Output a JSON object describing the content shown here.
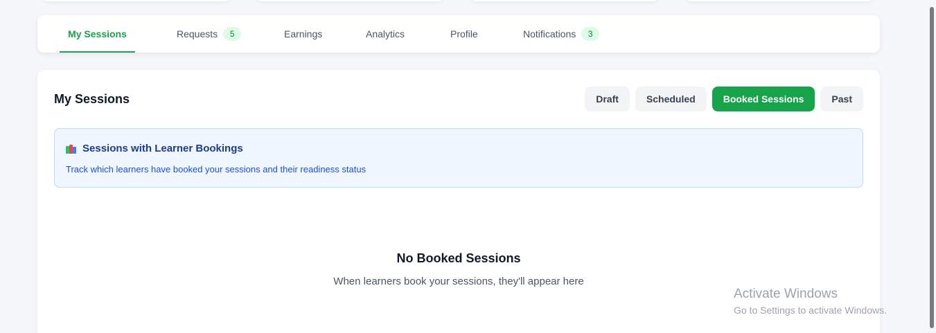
{
  "tabs": [
    {
      "label": "My Sessions",
      "badge": null,
      "active": true
    },
    {
      "label": "Requests",
      "badge": "5",
      "active": false
    },
    {
      "label": "Earnings",
      "badge": null,
      "active": false
    },
    {
      "label": "Analytics",
      "badge": null,
      "active": false
    },
    {
      "label": "Profile",
      "badge": null,
      "active": false
    },
    {
      "label": "Notifications",
      "badge": "3",
      "active": false
    }
  ],
  "main": {
    "title": "My Sessions",
    "filters": [
      {
        "label": "Draft",
        "active": false
      },
      {
        "label": "Scheduled",
        "active": false
      },
      {
        "label": "Booked Sessions",
        "active": true
      },
      {
        "label": "Past",
        "active": false
      }
    ],
    "info": {
      "icon": "books-icon",
      "title": "Sessions with Learner Bookings",
      "subtitle": "Track which learners have booked your sessions and their readiness status"
    },
    "empty": {
      "title": "No Booked Sessions",
      "subtitle": "When learners book your sessions, they'll appear here"
    }
  },
  "watermark": {
    "line1": "Activate Windows",
    "line2": "Go to Settings to activate Windows."
  },
  "colors": {
    "accent": "#16a34a",
    "badge_bg": "#dcfce7",
    "info_bg": "#eff6ff",
    "info_text": "#1e3a8a"
  }
}
